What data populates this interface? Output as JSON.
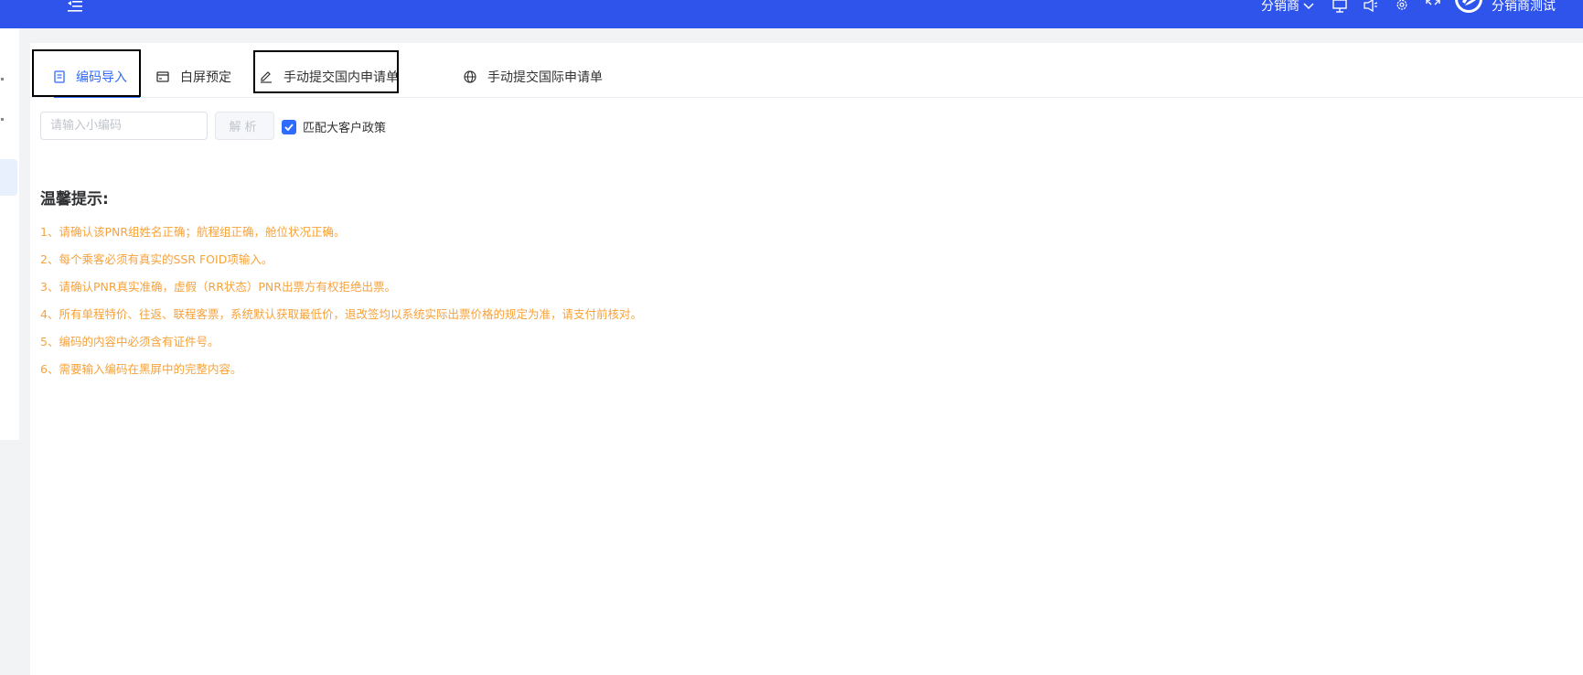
{
  "header": {
    "role_label": "分销商",
    "username": "分销商测试",
    "icons": [
      "menu-fold-icon",
      "monitor-icon",
      "speaker-icon",
      "settings-icon",
      "fullscreen-icon"
    ],
    "bg_color": "#2f54eb"
  },
  "tabs": [
    {
      "label": "编码导入",
      "icon": "document-icon",
      "active": true
    },
    {
      "label": "白屏预定",
      "icon": "card-icon",
      "active": false
    },
    {
      "label": "手动提交国内申请单",
      "icon": "edit-icon",
      "active": false
    },
    {
      "label": "手动提交国际申请单",
      "icon": "globe-icon",
      "active": false
    }
  ],
  "form": {
    "code_placeholder": "请输入小编码",
    "code_value": "",
    "parse_button": "解析",
    "match_policy_label": "匹配大客户政策",
    "match_policy_checked": true
  },
  "tips": {
    "title": "温馨提示:",
    "items": [
      "1、请确认该PNR组姓名正确；航程组正确，舱位状况正确。",
      "2、每个乘客必须有真实的SSR FOID项输入。",
      "3、请确认PNR真实准确，虚假（RR状态）PNR出票方有权拒绝出票。",
      "4、所有单程特价、往返、联程客票，系统默认获取最低价，退改签均以系统实际出票价格的规定为准，请支付前核对。",
      "5、编码的内容中必须含有证件号。",
      "6、需要输入编码在黑屏中的完整内容。"
    ],
    "color": "#f7a23b"
  },
  "accent_color": "#2f6bff"
}
